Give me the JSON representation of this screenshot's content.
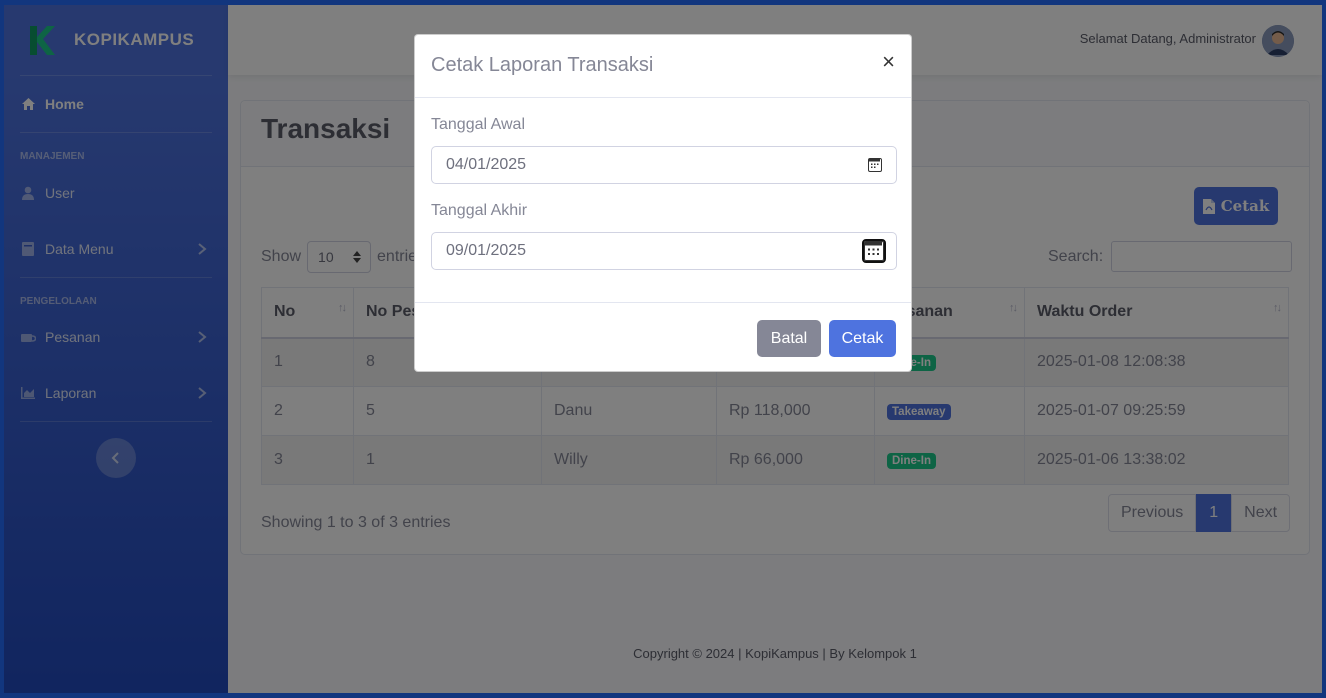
{
  "brand": {
    "name": "KOPIKAMPUS",
    "logo_color": "#1cc88a"
  },
  "sidebar": {
    "home": "Home",
    "heading_manajemen": "MANAJEMEN",
    "user": "User",
    "data_menu": "Data Menu",
    "heading_pengelolaan": "PENGELOLAAN",
    "pesanan": "Pesanan",
    "laporan": "Laporan"
  },
  "topbar": {
    "welcome": "Selamat Datang, Administrator"
  },
  "page": {
    "title": "Transaksi",
    "cetak_button": "Cetak"
  },
  "table_controls": {
    "show_label": "Show",
    "entries_label": "entries",
    "page_length": "10",
    "search_label": "Search:"
  },
  "table": {
    "columns": [
      "No",
      "No Pesanan",
      "",
      "",
      "Pesanan",
      "Waktu Order"
    ],
    "rows": [
      {
        "no": "1",
        "no_pesanan": "8",
        "nama": "",
        "total": "",
        "badge": "Dine-In",
        "badge_type": "dine",
        "waktu": "2025-01-08 12:08:38"
      },
      {
        "no": "2",
        "no_pesanan": "5",
        "nama": "Danu",
        "total": "Rp 118,000",
        "badge": "Takeaway",
        "badge_type": "take",
        "waktu": "2025-01-07 09:25:59"
      },
      {
        "no": "3",
        "no_pesanan": "1",
        "nama": "Willy",
        "total": "Rp 66,000",
        "badge": "Dine-In",
        "badge_type": "dine",
        "waktu": "2025-01-06 13:38:02"
      }
    ]
  },
  "pagination": {
    "info": "Showing 1 to 3 of 3 entries",
    "previous": "Previous",
    "current": "1",
    "next": "Next"
  },
  "footer": {
    "text": "Copyright © 2024 | KopiKampus | By Kelompok 1"
  },
  "modal": {
    "title": "Cetak Laporan Transaksi",
    "close": "×",
    "start_label": "Tanggal Awal",
    "start_value": "04/01/2025",
    "end_label": "Tanggal Akhir",
    "end_value": "09/01/2025",
    "cancel": "Batal",
    "submit": "Cetak"
  },
  "colors": {
    "primary": "#4e73df",
    "success": "#1cc88a",
    "secondary": "#858796"
  }
}
